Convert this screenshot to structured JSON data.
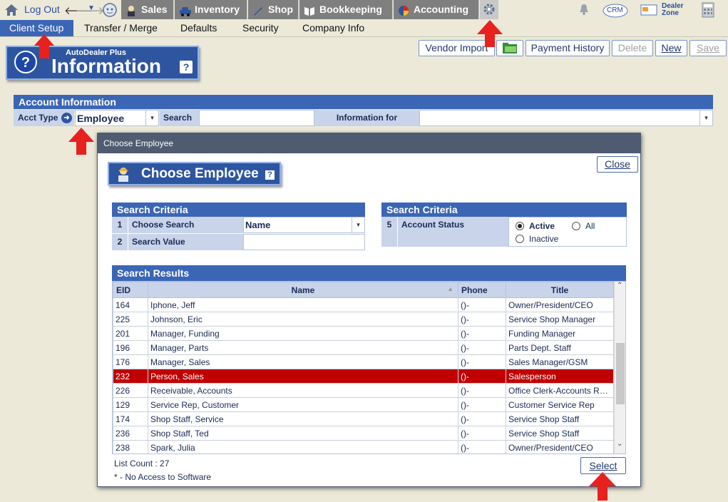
{
  "nav": {
    "logout": "Log Out",
    "tabs": [
      "Sales",
      "Inventory",
      "Shop",
      "Bookkeeping",
      "Accounting"
    ],
    "right_icons": {
      "crm": "CRM",
      "dealer_zone": "Dealer Zone"
    }
  },
  "subnav": [
    "Client Setup",
    "Transfer / Merge",
    "Defaults",
    "Security",
    "Company Info"
  ],
  "toolbar": {
    "vendor_import": "Vendor Import",
    "payment_history": "Payment History",
    "delete": "Delete",
    "new": "New",
    "save": "Save"
  },
  "banner": {
    "small": "AutoDealer Plus",
    "big": "Information"
  },
  "account": {
    "header": "Account Information",
    "acct_type_label": "Acct Type",
    "acct_type_value": "Employee",
    "search_label": "Search",
    "info_for_label": "Information for"
  },
  "modal": {
    "title": "Choose Employee",
    "banner": "Choose Employee",
    "close": "Close",
    "criteria_left": {
      "header": "Search Criteria",
      "rows": [
        {
          "num": "1",
          "label": "Choose Search",
          "value": "Name"
        },
        {
          "num": "2",
          "label": "Search Value",
          "value": ""
        }
      ]
    },
    "criteria_right": {
      "header": "Search Criteria",
      "num": "5",
      "label": "Account Status",
      "options": [
        "Active",
        "All",
        "Inactive"
      ],
      "selected": "Active"
    },
    "results": {
      "header": "Search Results",
      "columns": [
        "EID",
        "Name",
        "Phone",
        "Title"
      ],
      "rows": [
        [
          "164",
          "Iphone, Jeff",
          "()-",
          "Owner/President/CEO"
        ],
        [
          "225",
          "Johnson, Eric",
          "()-",
          "Service Shop Manager"
        ],
        [
          "201",
          "Manager, Funding",
          "()-",
          "Funding Manager"
        ],
        [
          "196",
          "Manager, Parts",
          "()-",
          "Parts Dept. Staff"
        ],
        [
          "176",
          "Manager, Sales",
          "()-",
          "Sales Manager/GSM"
        ],
        [
          "232",
          "Person, Sales",
          "()-",
          "Salesperson"
        ],
        [
          "226",
          "Receivable, Accounts",
          "()-",
          "Office Clerk-Accounts Recei..."
        ],
        [
          "129",
          "Service Rep, Customer",
          "()-",
          "Customer Service Rep"
        ],
        [
          "174",
          "Shop Staff, Service",
          "()-",
          "Service Shop Staff"
        ],
        [
          "236",
          "Shop Staff, Ted",
          "()-",
          "Service Shop Staff"
        ],
        [
          "238",
          "Spark, Julia",
          "()-",
          "Owner/President/CEO"
        ]
      ],
      "selected_index": 5
    },
    "list_count": "List Count : 27",
    "note": "* - No Access to Software",
    "select": "Select"
  },
  "colors": {
    "accent": "#3b66b6",
    "selected_row": "#c00000",
    "arrow": "#e8201e"
  }
}
